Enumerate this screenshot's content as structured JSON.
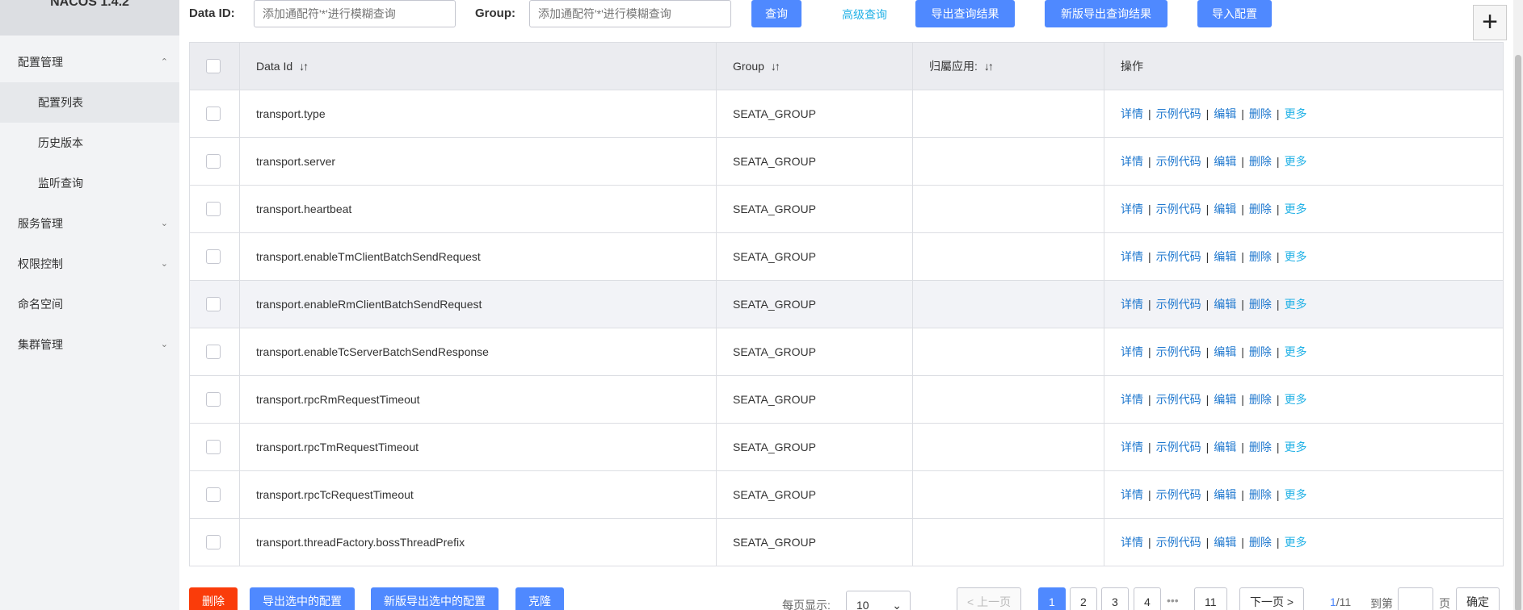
{
  "app": {
    "logo": "NACOS 1.4.2"
  },
  "sidebar": {
    "items": [
      {
        "label": "配置管理",
        "chevron": "^"
      },
      {
        "label": "配置列表"
      },
      {
        "label": "历史版本"
      },
      {
        "label": "监听查询"
      },
      {
        "label": "服务管理",
        "chevron": "v"
      },
      {
        "label": "权限控制",
        "chevron": "v"
      },
      {
        "label": "命名空间"
      },
      {
        "label": "集群管理",
        "chevron": "v"
      }
    ]
  },
  "toolbar": {
    "data_id_label": "Data ID:",
    "data_id_placeholder": "添加通配符'*'进行模糊查询",
    "group_label": "Group:",
    "group_placeholder": "添加通配符'*'进行模糊查询",
    "query": "查询",
    "advanced_query": "高级查询",
    "export_results": "导出查询结果",
    "new_export_results": "新版导出查询结果",
    "import_config": "导入配置",
    "add": "+"
  },
  "table": {
    "headers": [
      "Data Id",
      "Group",
      "归屬应用:",
      "操作"
    ],
    "sort_icon": "↓↑",
    "rows": [
      {
        "data_id": "transport.type",
        "group": "SEATA_GROUP",
        "app": ""
      },
      {
        "data_id": "transport.server",
        "group": "SEATA_GROUP",
        "app": ""
      },
      {
        "data_id": "transport.heartbeat",
        "group": "SEATA_GROUP",
        "app": ""
      },
      {
        "data_id": "transport.enableTmClientBatchSendRequest",
        "group": "SEATA_GROUP",
        "app": ""
      },
      {
        "data_id": "transport.enableRmClientBatchSendRequest",
        "group": "SEATA_GROUP",
        "app": ""
      },
      {
        "data_id": "transport.enableTcServerBatchSendResponse",
        "group": "SEATA_GROUP",
        "app": ""
      },
      {
        "data_id": "transport.rpcRmRequestTimeout",
        "group": "SEATA_GROUP",
        "app": ""
      },
      {
        "data_id": "transport.rpcTmRequestTimeout",
        "group": "SEATA_GROUP",
        "app": ""
      },
      {
        "data_id": "transport.rpcTcRequestTimeout",
        "group": "SEATA_GROUP",
        "app": ""
      },
      {
        "data_id": "transport.threadFactory.bossThreadPrefix",
        "group": "SEATA_GROUP",
        "app": ""
      }
    ],
    "ops": {
      "detail": "详情",
      "sample": "示例代码",
      "edit": "编辑",
      "delete": "删除",
      "more": "更多",
      "sep": "|"
    }
  },
  "footer": {
    "delete": "删除",
    "export_selected": "导出选中的配置",
    "new_export_selected": "新版导出选中的配置",
    "clone": "克隆",
    "page_size_label": "每页显示:",
    "page_size": "10",
    "prev": "< 上一页",
    "pages": [
      "1",
      "2",
      "3",
      "4"
    ],
    "ellipsis": "•••",
    "last_page": "11",
    "next": "下一页 >",
    "page_current": "1",
    "page_total": "/11",
    "goto_label": "到第",
    "page_unit": "页",
    "confirm": "确定"
  },
  "colors": {
    "primary": "#4f89ff",
    "danger": "#fa3c0a",
    "link": "#1e77ce",
    "link_light": "#21b1e6"
  }
}
